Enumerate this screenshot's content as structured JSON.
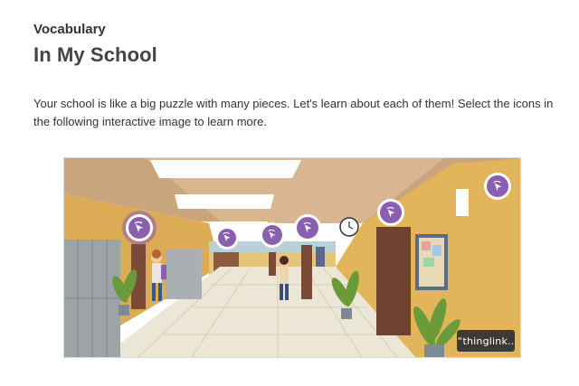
{
  "header": {
    "eyebrow": "Vocabulary",
    "title": "In My School"
  },
  "intro": {
    "text": "Your school is like a big puzzle with many pieces. Let's learn about each of them! Select the icons in the following interactive image to learn more."
  },
  "image": {
    "badge": "“thinglink.."
  },
  "icons": {
    "hotspot": "tap-icon",
    "clock": "clock-icon"
  },
  "colors": {
    "hotspot": "#8a5fb0",
    "wall": "#e2b55a",
    "locker": "#9ea3a6",
    "door": "#7a4a36",
    "badge_bg": "#3d3a36"
  }
}
